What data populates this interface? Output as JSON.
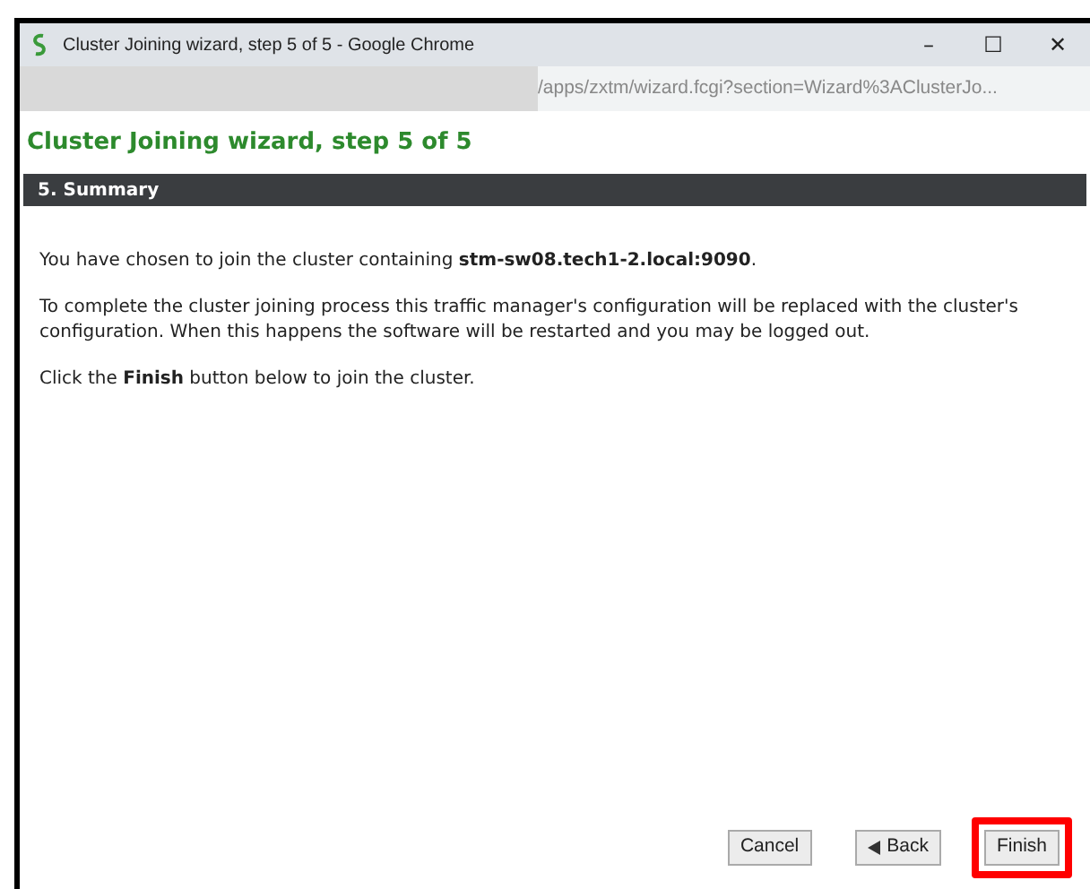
{
  "window": {
    "title": "Cluster Joining wizard, step 5 of 5 - Google Chrome",
    "controls": [
      "–",
      "☐",
      "✕"
    ]
  },
  "address_bar": {
    "url": "/apps/zxtm/wizard.fcgi?section=Wizard%3AClusterJo..."
  },
  "page": {
    "heading": "Cluster Joining wizard, step 5 of 5",
    "section_title": "5. Summary",
    "paragraphs": [
      "You have chosen to join the cluster containing **stm-sw08.tech1-2.local:9090**.",
      "To complete the cluster joining process this traffic manager's configuration will be replaced with the cluster's configuration. When this happens the software will be restarted and you may be logged out.",
      "Click the **Finish** button below to join the cluster."
    ]
  },
  "buttons": [
    {
      "label": "Cancel",
      "kind": "plain",
      "highlighted": false
    },
    {
      "label": "Back",
      "kind": "back",
      "highlighted": false
    },
    {
      "label": "Finish",
      "kind": "plain",
      "highlighted": true
    }
  ]
}
